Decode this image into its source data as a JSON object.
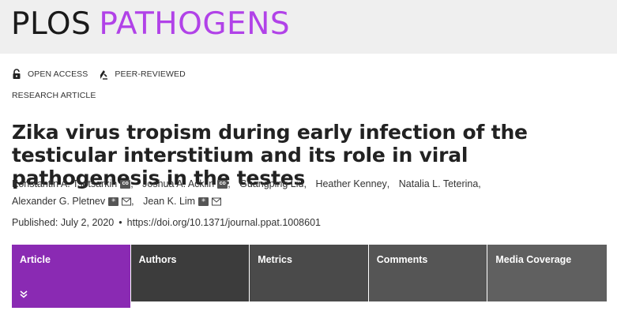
{
  "journal": {
    "brand": "PLOS",
    "name": "PATHOGENS",
    "brand_color": "#1a1a1a",
    "name_color": "#b142e8"
  },
  "badges": [
    {
      "label": "OPEN ACCESS",
      "icon": "open-lock-icon"
    },
    {
      "label": "PEER-REVIEWED",
      "icon": "peer-reviewed-icon"
    }
  ],
  "article_type": "RESEARCH ARTICLE",
  "title": "Zika virus tropism during early infection of the testicular interstitium and its role in viral pathogenesis in the testes",
  "authors": [
    {
      "name": "Konstantin A. Tsetsarkin",
      "icons": [
        "contrib-icon"
      ]
    },
    {
      "name": "Joshua A. Acklin",
      "icons": [
        "contrib-icon"
      ]
    },
    {
      "name": "Guangping Liu",
      "icons": []
    },
    {
      "name": "Heather Kenney",
      "icons": []
    },
    {
      "name": "Natalia L. Teterina",
      "icons": []
    },
    {
      "name": "Alexander G. Pletnev",
      "icons": [
        "corresponding-author-icon",
        "email-icon"
      ]
    },
    {
      "name": "Jean K. Lim",
      "icons": [
        "corresponding-author-icon",
        "email-icon"
      ]
    }
  ],
  "published": {
    "label": "Published: July 2, 2020",
    "separator": "•",
    "doi": "https://doi.org/10.1371/journal.ppat.1008601"
  },
  "tabs": [
    {
      "label": "Article",
      "active": true
    },
    {
      "label": "Authors",
      "active": false
    },
    {
      "label": "Metrics",
      "active": false
    },
    {
      "label": "Comments",
      "active": false
    },
    {
      "label": "Media Coverage",
      "active": false
    }
  ],
  "colors": {
    "active_tab": "#8a2ab3",
    "tab_bg": "#555555",
    "masthead_bg": "#efefef"
  }
}
